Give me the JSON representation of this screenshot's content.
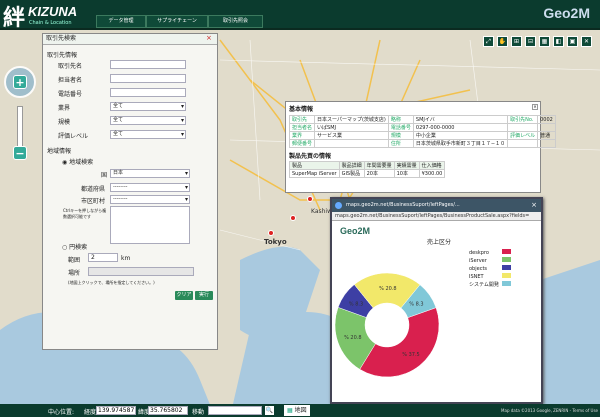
{
  "header": {
    "logo_kanji": "絆",
    "logo_text": "KIZUNA",
    "logo_sub": "Chain & Location",
    "menu": [
      "データ管理",
      "サプライチェーン",
      "取引先照会"
    ],
    "brand": "Geo2M"
  },
  "toolbar": {
    "icons": [
      "zoom-in-icon",
      "hand-icon",
      "expand-icon",
      "zoom-out-icon",
      "grid-icon",
      "layer-icon",
      "box-icon",
      "close-icon"
    ]
  },
  "panel": {
    "title": "取引先検索",
    "close": "×",
    "section1": "取引先情報",
    "fields": [
      {
        "label": "取引先名",
        "value": ""
      },
      {
        "label": "担当者名",
        "value": ""
      },
      {
        "label": "電話番号",
        "value": ""
      }
    ],
    "selects": [
      {
        "label": "業界",
        "value": "全て"
      },
      {
        "label": "規模",
        "value": "全て"
      },
      {
        "label": "評価レベル",
        "value": "全て"
      }
    ],
    "section2": "地域情報",
    "radio1": "地域検索",
    "country_label": "国",
    "country_value": "日本",
    "pref_label": "都道府県",
    "pref_value": "--------",
    "city_label": "市区町村",
    "city_value": "--------",
    "city_note": "Ctrlキーを押しながら複数選択可能です",
    "radio2": "円検索",
    "radius_label": "範囲",
    "radius_value": "2",
    "radius_unit": "km",
    "place_label": "場所",
    "place_note": "(地図上クリックで、場所を指定してください。)",
    "clear": "クリア",
    "run": "実行"
  },
  "info": {
    "title": "基本情報",
    "rows": [
      [
        "取引先",
        "日本スーパーマップ(茨城支店)",
        "略称",
        "SMJイバ",
        "取引先No.",
        "0002"
      ],
      [
        "担当者名",
        "いばSMJ",
        "電話番号",
        "0297-000-0000",
        "",
        ""
      ],
      [
        "業界",
        "サービス業",
        "規模",
        "中小企業",
        "評価レベル",
        "普通"
      ],
      [
        "郵便番号",
        "",
        "住所",
        "日本茨城県取手市新町３丁目１７−１０",
        "",
        ""
      ]
    ],
    "prod_title": "製品先買の情報",
    "prod_head": [
      "製品",
      "製品詳細",
      "年間需要量",
      "実績需量",
      "仕入価格"
    ],
    "prod_row": [
      "SuperMap iServer",
      "GIS製品",
      "20本",
      "10本",
      "¥300.00"
    ]
  },
  "popup": {
    "bar": "maps.geo2m.net/BusinessSuport/leftPages/...",
    "url": "maps.geo2m.net/BusinessSuport/leftPages/BusinessProductSale.aspx?fields=",
    "brand": "Geo2M",
    "close": "×"
  },
  "chart_data": {
    "type": "pie",
    "title": "売上区分",
    "categories": [
      "deskpro",
      "iServer",
      "objects",
      "ISNET",
      "システム開発"
    ],
    "values": [
      37.5,
      20.8,
      8.3,
      20.8,
      8.3
    ],
    "labels": [
      "% 37.5",
      "% 20.8",
      "% 8.3",
      "% 20.8",
      "% 8.3"
    ],
    "colors": [
      "#d9204e",
      "#7cc46a",
      "#3d3fa4",
      "#f2e86a",
      "#80c8d8"
    ],
    "legend": "right"
  },
  "map_labels": [
    "Kashiwa",
    "Tokyo"
  ],
  "status": {
    "center_label": "中心位置:",
    "lng_label": "経度",
    "lng": "139.974587",
    "lat_label": "緯度",
    "lat": "35.765802",
    "move": "移動",
    "mapname": "地図",
    "copyright": "Map data ©2013 Google, ZENRIN - Terms of Use"
  }
}
